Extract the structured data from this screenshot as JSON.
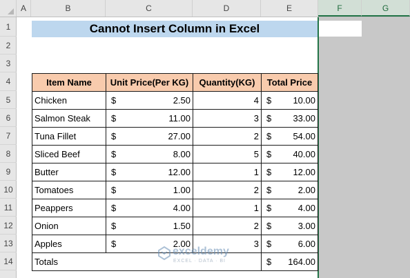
{
  "columns": [
    "A",
    "B",
    "C",
    "D",
    "E",
    "F",
    "G"
  ],
  "rows": [
    "1",
    "2",
    "3",
    "4",
    "5",
    "6",
    "7",
    "8",
    "9",
    "10",
    "11",
    "12",
    "13",
    "14"
  ],
  "title": "Cannot Insert Column in Excel",
  "table": {
    "headers": [
      "Item Name",
      "Unit Price(Per KG)",
      "Quantity(KG)",
      "Total Price"
    ],
    "rows": [
      {
        "name": "Chicken",
        "price": "2.50",
        "qty": "4",
        "total": "10.00"
      },
      {
        "name": "Salmon Steak",
        "price": "11.00",
        "qty": "3",
        "total": "33.00"
      },
      {
        "name": "Tuna Fillet",
        "price": "27.00",
        "qty": "2",
        "total": "54.00"
      },
      {
        "name": "Sliced Beef",
        "price": "8.00",
        "qty": "5",
        "total": "40.00"
      },
      {
        "name": "Butter",
        "price": "12.00",
        "qty": "1",
        "total": "12.00"
      },
      {
        "name": "Tomatoes",
        "price": "1.00",
        "qty": "2",
        "total": "2.00"
      },
      {
        "name": "Peappers",
        "price": "4.00",
        "qty": "1",
        "total": "4.00"
      },
      {
        "name": "Onion",
        "price": "1.50",
        "qty": "2",
        "total": "3.00"
      },
      {
        "name": "Apples",
        "price": "2.00",
        "qty": "3",
        "total": "6.00"
      }
    ],
    "currency": "$",
    "totals_label": "Totals",
    "grand_total": "164.00"
  },
  "watermark": {
    "name": "exceldemy",
    "tagline": "EXCEL · DATA · BI"
  },
  "colors": {
    "title_fill": "#bdd7ee",
    "header_fill": "#f8cbad",
    "selection": "#217346",
    "gray_area": "#c8c8c8"
  }
}
